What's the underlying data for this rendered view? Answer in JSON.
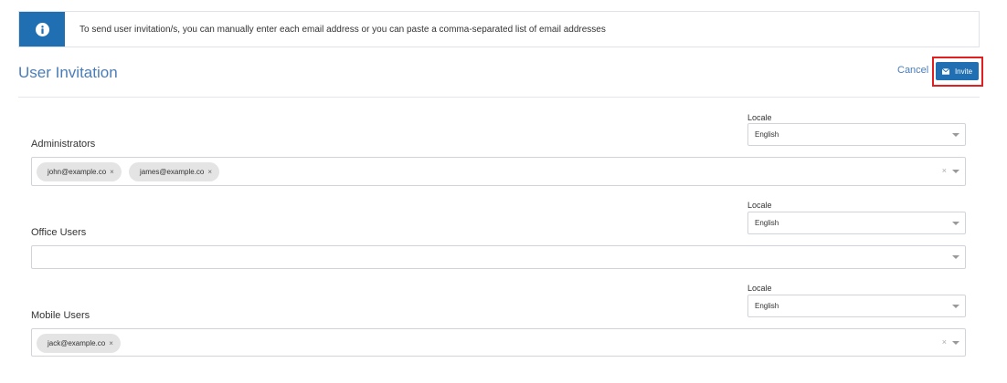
{
  "banner": {
    "icon": "info-icon",
    "text": "To send user invitation/s, you can manually enter each email address or you can paste a comma-separated list of email addresses"
  },
  "header": {
    "title": "User Invitation",
    "cancel_label": "Cancel",
    "invite_label": "Invite",
    "invite_icon": "envelope-icon"
  },
  "groups": [
    {
      "label": "Administrators",
      "locale_label": "Locale",
      "locale_value": "English",
      "emails": [
        "john@example.co",
        "james@example.co"
      ]
    },
    {
      "label": "Office Users",
      "locale_label": "Locale",
      "locale_value": "English",
      "emails": []
    },
    {
      "label": "Mobile Users",
      "locale_label": "Locale",
      "locale_value": "English",
      "emails": [
        "jack@example.co"
      ]
    }
  ],
  "chip_remove_symbol": "×",
  "clear_symbol": "×",
  "colors": {
    "accent": "#1f6fb2",
    "title": "#4a7db8",
    "highlight": "#e02020",
    "chip": "#e4e4e4"
  }
}
